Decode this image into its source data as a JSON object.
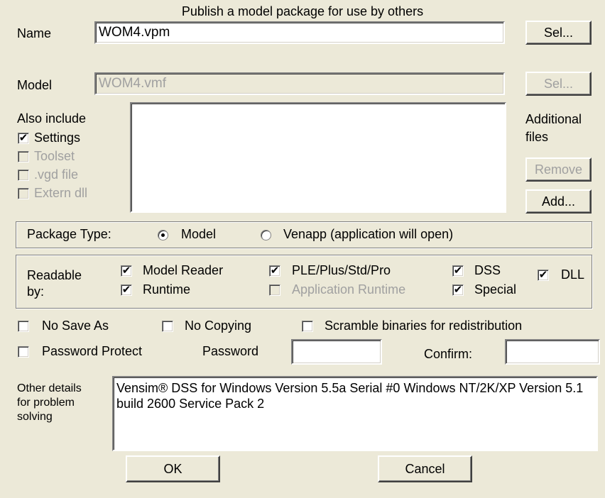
{
  "dialog": {
    "title": "Publish a model package for use by others"
  },
  "name_row": {
    "label": "Name",
    "value": "WOM4.vpm",
    "button": "Sel..."
  },
  "model_row": {
    "label": "Model",
    "value": "WOM4.vmf",
    "button": "Sel..."
  },
  "also_include": {
    "label": "Also include",
    "items": [
      {
        "label": "Settings",
        "checked": true,
        "enabled": true
      },
      {
        "label": "Toolset",
        "checked": false,
        "enabled": false
      },
      {
        "label": ".vgd file",
        "checked": false,
        "enabled": false
      },
      {
        "label": "Extern dll",
        "checked": false,
        "enabled": false
      }
    ]
  },
  "additional_files": {
    "label_line1": "Additional",
    "label_line2": "files",
    "remove_button": "Remove",
    "add_button": "Add..."
  },
  "package_type": {
    "label": "Package Type:",
    "options": [
      {
        "label": "Model",
        "selected": true
      },
      {
        "label": "Venapp (application will open)",
        "selected": false
      }
    ]
  },
  "readable_by": {
    "label_line1": "Readable",
    "label_line2": "by:",
    "items": [
      {
        "label": "Model Reader",
        "checked": true,
        "enabled": true
      },
      {
        "label": "Runtime",
        "checked": true,
        "enabled": true
      },
      {
        "label": "PLE/Plus/Std/Pro",
        "checked": true,
        "enabled": true
      },
      {
        "label": "Application Runtime",
        "checked": false,
        "enabled": false
      },
      {
        "label": "DSS",
        "checked": true,
        "enabled": true
      },
      {
        "label": "Special",
        "checked": true,
        "enabled": true
      },
      {
        "label": "DLL",
        "checked": true,
        "enabled": true
      }
    ]
  },
  "options": {
    "no_save_as": "No Save As",
    "no_copying": "No Copying",
    "scramble": "Scramble binaries for redistribution",
    "password_protect": "Password Protect",
    "password_label": "Password",
    "confirm_label": "Confirm:"
  },
  "other_details": {
    "label_line1": "Other details",
    "label_line2": "for problem",
    "label_line3": "solving",
    "text": "Vensim® DSS for Windows Version 5.5a Serial #0  Windows NT/2K/XP Version 5.1 build 2600 Service Pack 2"
  },
  "buttons": {
    "ok": "OK",
    "cancel": "Cancel"
  },
  "check_glyph": "✔",
  "colors": {
    "background": "#ece9d8",
    "disabled_text": "#a0a0a0"
  }
}
